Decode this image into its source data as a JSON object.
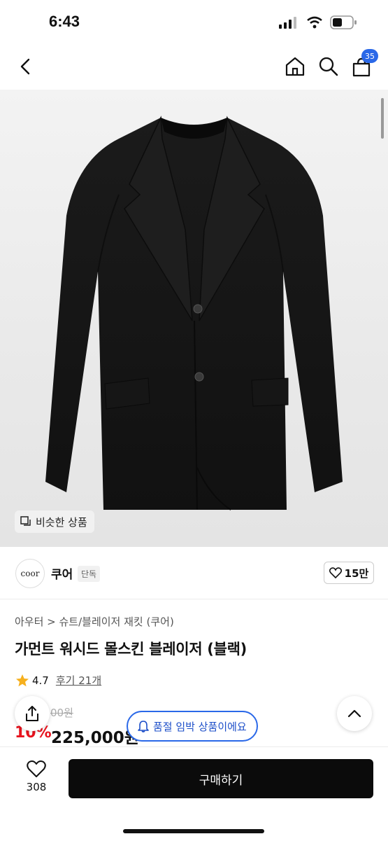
{
  "status": {
    "time": "6:43"
  },
  "nav": {
    "cart_count": "35"
  },
  "hero": {
    "similar_label": "비슷한 상품"
  },
  "brand": {
    "logo_text": "coor",
    "name": "쿠어",
    "badge": "단독",
    "likes": "15만"
  },
  "product": {
    "breadcrumb": "아우터 > 슈트/블레이저 재킷 (쿠어)",
    "title": "가먼트 워시드 몰스킨 블레이저 (블랙)",
    "rating": "4.7",
    "review": "후기 21개",
    "original_price": "00원",
    "discount": "10%",
    "price": "225,000원"
  },
  "toast": {
    "text": "품절 임박 상품이에요"
  },
  "bottom": {
    "heart_count": "308",
    "buy_label": "구매하기"
  },
  "colors": {
    "accent": "#2a68e8",
    "discount": "#e8131e",
    "buy": "#0b0b0b"
  }
}
